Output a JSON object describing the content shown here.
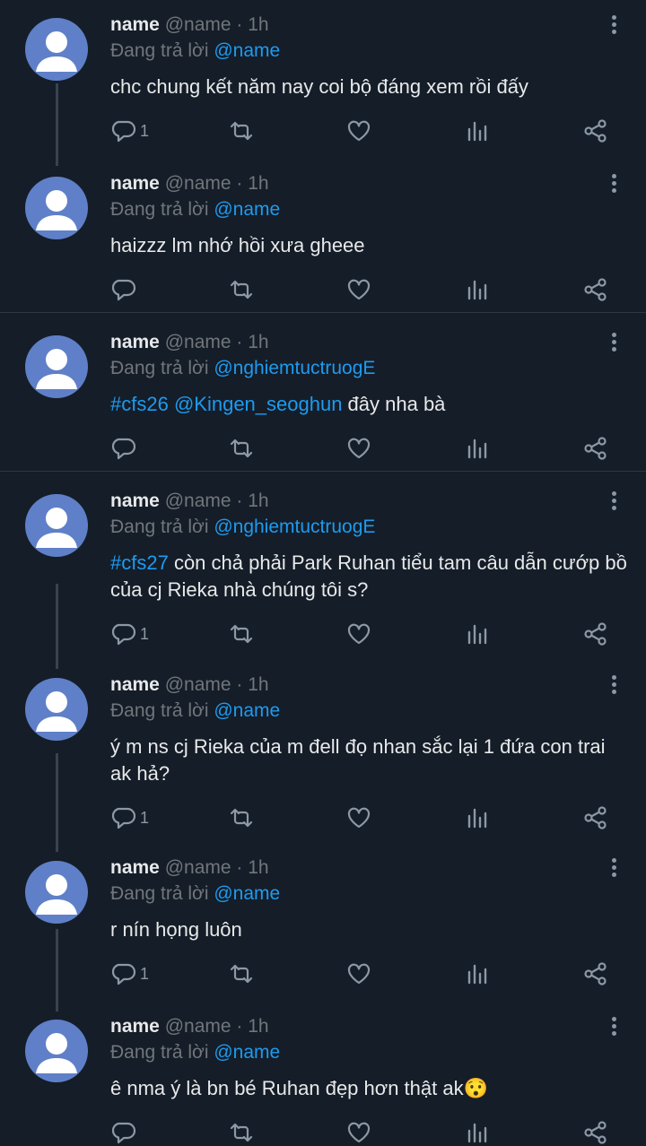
{
  "tweets": [
    {
      "name": "name",
      "handle": "@name",
      "time": "1h",
      "reply_prefix": "Đang trả lời",
      "reply_to": "@name",
      "text_parts": [
        {
          "t": "chc chung kết năm nay coi bộ đáng xem rồi đấy",
          "link": false
        }
      ],
      "reply_count": "1"
    },
    {
      "name": "name",
      "handle": "@name",
      "time": "1h",
      "reply_prefix": "Đang trả lời",
      "reply_to": "@name",
      "text_parts": [
        {
          "t": "haizzz lm nhớ hồi xưa gheee",
          "link": false
        }
      ],
      "reply_count": ""
    },
    {
      "name": "name",
      "handle": "@name",
      "time": "1h",
      "reply_prefix": "Đang trả lời",
      "reply_to": "@nghiemtuctruogE",
      "text_parts": [
        {
          "t": "#cfs26",
          "link": true
        },
        {
          "t": " ",
          "link": false
        },
        {
          "t": "@Kingen_seoghun",
          "link": true
        },
        {
          "t": " đây nha bà",
          "link": false
        }
      ],
      "reply_count": ""
    },
    {
      "name": "name",
      "handle": "@name",
      "time": "1h",
      "reply_prefix": "Đang trả lời",
      "reply_to": "@nghiemtuctruogE",
      "text_parts": [
        {
          "t": "#cfs27",
          "link": true
        },
        {
          "t": " còn chả phải Park Ruhan tiểu tam câu dẫn cướp bồ của cj Rieka nhà chúng tôi s?",
          "link": false
        }
      ],
      "reply_count": "1"
    },
    {
      "name": "name",
      "handle": "@name",
      "time": "1h",
      "reply_prefix": "Đang trả lời",
      "reply_to": "@name",
      "text_parts": [
        {
          "t": "ý m ns cj Rieka của m đell đọ nhan sắc lại 1 đứa con trai ak hả?",
          "link": false
        }
      ],
      "reply_count": "1"
    },
    {
      "name": "name",
      "handle": "@name",
      "time": "1h",
      "reply_prefix": "Đang trả lời",
      "reply_to": "@name",
      "text_parts": [
        {
          "t": "r nín họng luôn",
          "link": false
        }
      ],
      "reply_count": "1"
    },
    {
      "name": "name",
      "handle": "@name",
      "time": "1h",
      "reply_prefix": "Đang trả lời",
      "reply_to": "@name",
      "text_parts": [
        {
          "t": "ê nma ý là bn bé Ruhan đẹp hơn thật ak😯",
          "link": false
        }
      ],
      "reply_count": ""
    }
  ],
  "icons": {
    "reply": "reply-icon",
    "retweet": "retweet-icon",
    "like": "like-icon",
    "views": "views-icon",
    "share": "share-icon",
    "more": "more-icon",
    "avatar": "avatar-icon"
  },
  "colors": {
    "background": "#151d28",
    "link": "#1d9bf0",
    "muted": "#71767b",
    "avatar": "#5f80c8"
  }
}
